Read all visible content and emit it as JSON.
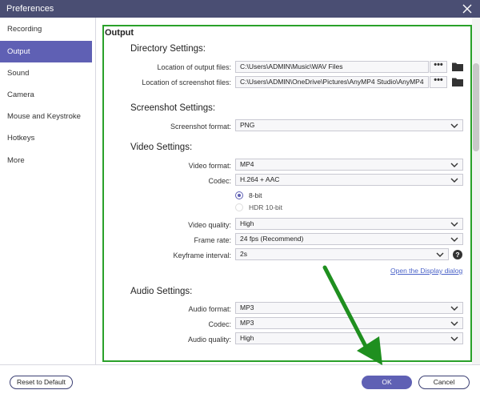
{
  "window": {
    "title": "Preferences"
  },
  "sidebar": {
    "items": [
      {
        "label": "Recording"
      },
      {
        "label": "Output"
      },
      {
        "label": "Sound"
      },
      {
        "label": "Camera"
      },
      {
        "label": "Mouse and Keystroke"
      },
      {
        "label": "Hotkeys"
      },
      {
        "label": "More"
      }
    ],
    "active": "Output"
  },
  "output": {
    "title": "Output",
    "directory": {
      "heading": "Directory Settings:",
      "output_files_label": "Location of output files:",
      "output_files_value": "C:\\Users\\ADMIN\\Music\\WAV Files",
      "screenshot_files_label": "Location of screenshot files:",
      "screenshot_files_value": "C:\\Users\\ADMIN\\OneDrive\\Pictures\\AnyMP4 Studio\\AnyMP4",
      "more_button": "•••"
    },
    "screenshot": {
      "heading": "Screenshot Settings:",
      "format_label": "Screenshot format:",
      "format_value": "PNG"
    },
    "video": {
      "heading": "Video Settings:",
      "format_label": "Video format:",
      "format_value": "MP4",
      "codec_label": "Codec:",
      "codec_value": "H.264 + AAC",
      "bit_8": "8-bit",
      "bit_hdr": "HDR 10-bit",
      "quality_label": "Video quality:",
      "quality_value": "High",
      "framerate_label": "Frame rate:",
      "framerate_value": "24 fps (Recommend)",
      "keyframe_label": "Keyframe interval:",
      "keyframe_value": "2s",
      "help": "?",
      "display_link": "Open the Display dialog"
    },
    "audio": {
      "heading": "Audio Settings:",
      "format_label": "Audio format:",
      "format_value": "MP3",
      "codec_label": "Codec:",
      "codec_value": "MP3",
      "quality_label": "Audio quality:",
      "quality_value": "High"
    }
  },
  "footer": {
    "reset_label": "Reset to Default",
    "ok_label": "OK",
    "cancel_label": "Cancel"
  },
  "colors": {
    "titlebar": "#4a4e73",
    "accent": "#5f60b4",
    "highlight_border": "#2aa12a",
    "annotation_arrow": "#1f8f1f"
  },
  "icons": [
    "close-icon",
    "folder-icon",
    "chevron-down-icon",
    "help-icon",
    "annotation-arrow"
  ]
}
